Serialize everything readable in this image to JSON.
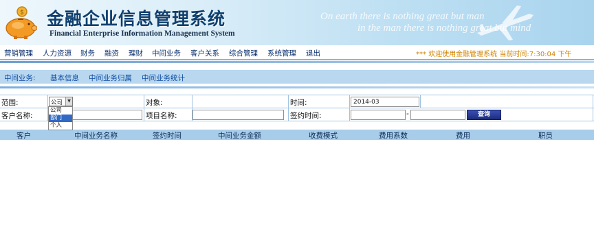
{
  "header": {
    "title_cn": "金融企业信息管理系统",
    "title_en": "Financial Enterprise Information Management System",
    "slogan_line1": "On earth there is nothing great but man",
    "slogan_line2": "in the man there is nothing great but mind",
    "logo_icon": "piggy-bank-icon",
    "plane_icon": "airplane-icon"
  },
  "menu": {
    "items": [
      "营销管理",
      "人力资源",
      "财务",
      "融资",
      "理财",
      "中间业务",
      "客户关系",
      "综合管理",
      "系统管理",
      "退出"
    ],
    "welcome": "*** 欢迎使用金融管理系统   当前时间:7:30:04 下午"
  },
  "subnav": {
    "items": [
      "中间业务:",
      "基本信息",
      "中间业务归属",
      "中间业务统计"
    ]
  },
  "form": {
    "scope_label": "范围:",
    "scope_value": "公司",
    "scope_options": [
      "公司",
      "部门",
      "个人"
    ],
    "scope_highlighted": "部门",
    "object_label": "对象:",
    "object_value": "",
    "time_label": "时间:",
    "time_value": "2014-03",
    "customer_label": "客户名称:",
    "customer_value": "",
    "project_label": "项目名称:",
    "project_value": "",
    "sign_time_label": "签约时间:",
    "sign_from": "",
    "sign_dash": "-",
    "sign_to": "",
    "query_button": "查询"
  },
  "table": {
    "columns": [
      "客户",
      "中间业务名称",
      "签约时间",
      "中间业务金额",
      "收费模式",
      "费用系数",
      "费用",
      "职员"
    ],
    "rows": []
  },
  "colors": {
    "title": "#0f3f6e",
    "menu_text": "#0a2f6c",
    "welcome_text": "#d08400",
    "subnav_bg": "#b9d8f0",
    "table_header_bg": "#a7cdea",
    "button_bg": "#1d2c7e"
  }
}
